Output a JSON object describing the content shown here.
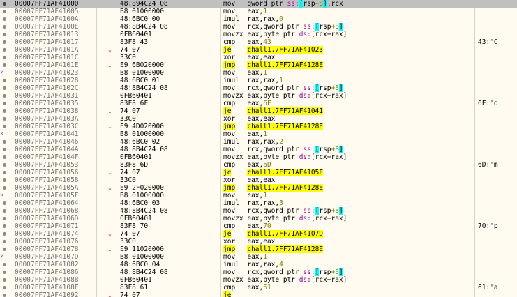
{
  "view": "disassembly",
  "rows": [
    {
      "addr": "00007FF71AF41000",
      "bytes": "48:894C24 08",
      "ins": "mov",
      "ops": [
        [
          "reg",
          "qword ptr "
        ],
        [
          "seg",
          "ss:"
        ],
        [
          "br",
          "["
        ],
        [
          "reg",
          "rsp"
        ],
        [
          "imm",
          "+8"
        ],
        [
          "br",
          "]"
        ],
        [
          "reg",
          ",rcx"
        ]
      ],
      "comment": "",
      "jump": false,
      "sel": true,
      "arrow": ""
    },
    {
      "addr": "00007FF71AF41005",
      "bytes": "B8 01000000",
      "ins": "mov",
      "ops": [
        [
          "reg",
          "eax,"
        ],
        [
          "imm",
          "1"
        ]
      ],
      "comment": "",
      "jump": false
    },
    {
      "addr": "00007FF71AF4100A",
      "bytes": "48:6BC0 00",
      "ins": "imul",
      "ops": [
        [
          "reg",
          "rax,rax,"
        ],
        [
          "imm",
          "0"
        ]
      ],
      "comment": "",
      "jump": false
    },
    {
      "addr": "00007FF71AF4100E",
      "bytes": "48:8B4C24 08",
      "ins": "mov",
      "ops": [
        [
          "reg",
          "rcx,qword ptr "
        ],
        [
          "seg",
          "ss:"
        ],
        [
          "br",
          "["
        ],
        [
          "reg",
          "rsp"
        ],
        [
          "imm",
          "+8"
        ],
        [
          "br",
          "]"
        ]
      ],
      "comment": "",
      "jump": false
    },
    {
      "addr": "00007FF71AF41013",
      "bytes": "0FB60401",
      "ins": "movzx",
      "ops": [
        [
          "reg",
          "eax,byte ptr "
        ],
        [
          "seg",
          "ds:"
        ],
        [
          "reg",
          "[rcx+rax]"
        ]
      ],
      "comment": "",
      "jump": false
    },
    {
      "addr": "00007FF71AF41017",
      "bytes": "83F8 43",
      "ins": "cmp",
      "ops": [
        [
          "reg",
          "eax,"
        ],
        [
          "imm",
          "43"
        ]
      ],
      "comment": "43:'C'",
      "jump": false
    },
    {
      "addr": "00007FF71AF4101A",
      "bytes": "74 07",
      "ins": "je",
      "ops": [
        [
          "tgt",
          "chall1.7FF71AF41023"
        ]
      ],
      "comment": "",
      "jump": true,
      "chev": true
    },
    {
      "addr": "00007FF71AF4101C",
      "bytes": "33C0",
      "ins": "xor",
      "ops": [
        [
          "reg",
          "eax,eax"
        ]
      ],
      "comment": "",
      "jump": false
    },
    {
      "addr": "00007FF71AF4101E",
      "bytes": "E9 6B020000",
      "ins": "jmp",
      "ops": [
        [
          "tgt",
          "chall1.7FF71AF4128E"
        ]
      ],
      "comment": "",
      "jump": true,
      "chev": true
    },
    {
      "addr": "00007FF71AF41023",
      "bytes": "B8 01000000",
      "ins": "mov",
      "ops": [
        [
          "reg",
          "eax,"
        ],
        [
          "imm",
          "1"
        ]
      ],
      "comment": "",
      "jump": false,
      "arrow": "->"
    },
    {
      "addr": "00007FF71AF41028",
      "bytes": "48:6BC0 01",
      "ins": "imul",
      "ops": [
        [
          "reg",
          "rax,rax,"
        ],
        [
          "imm",
          "1"
        ]
      ],
      "comment": "",
      "jump": false
    },
    {
      "addr": "00007FF71AF4102C",
      "bytes": "48:8B4C24 08",
      "ins": "mov",
      "ops": [
        [
          "reg",
          "rcx,qword ptr "
        ],
        [
          "seg",
          "ss:"
        ],
        [
          "br",
          "["
        ],
        [
          "reg",
          "rsp"
        ],
        [
          "imm",
          "+8"
        ],
        [
          "br",
          "]"
        ]
      ],
      "comment": "",
      "jump": false
    },
    {
      "addr": "00007FF71AF41031",
      "bytes": "0FB60401",
      "ins": "movzx",
      "ops": [
        [
          "reg",
          "eax,byte ptr "
        ],
        [
          "seg",
          "ds:"
        ],
        [
          "reg",
          "[rcx+rax]"
        ]
      ],
      "comment": "",
      "jump": false
    },
    {
      "addr": "00007FF71AF41035",
      "bytes": "83F8 6F",
      "ins": "cmp",
      "ops": [
        [
          "reg",
          "eax,"
        ],
        [
          "imm",
          "6F"
        ]
      ],
      "comment": "6F:'o'",
      "jump": false
    },
    {
      "addr": "00007FF71AF41038",
      "bytes": "74 07",
      "ins": "je",
      "ops": [
        [
          "tgt",
          "chall1.7FF71AF41041"
        ]
      ],
      "comment": "",
      "jump": true,
      "chev": true
    },
    {
      "addr": "00007FF71AF4103A",
      "bytes": "33C0",
      "ins": "xor",
      "ops": [
        [
          "reg",
          "eax,eax"
        ]
      ],
      "comment": "",
      "jump": false
    },
    {
      "addr": "00007FF71AF4103C",
      "bytes": "E9 4D020000",
      "ins": "jmp",
      "ops": [
        [
          "tgt",
          "chall1.7FF71AF4128E"
        ]
      ],
      "comment": "",
      "jump": true,
      "chev": true
    },
    {
      "addr": "00007FF71AF41041",
      "bytes": "B8 01000000",
      "ins": "mov",
      "ops": [
        [
          "reg",
          "eax,"
        ],
        [
          "imm",
          "1"
        ]
      ],
      "comment": "",
      "jump": false,
      "arrow": "->"
    },
    {
      "addr": "00007FF71AF41046",
      "bytes": "48:6BC0 02",
      "ins": "imul",
      "ops": [
        [
          "reg",
          "rax,rax,"
        ],
        [
          "imm",
          "2"
        ]
      ],
      "comment": "",
      "jump": false
    },
    {
      "addr": "00007FF71AF4104A",
      "bytes": "48:8B4C24 08",
      "ins": "mov",
      "ops": [
        [
          "reg",
          "rcx,qword ptr "
        ],
        [
          "seg",
          "ss:"
        ],
        [
          "br",
          "["
        ],
        [
          "reg",
          "rsp"
        ],
        [
          "imm",
          "+8"
        ],
        [
          "br",
          "]"
        ]
      ],
      "comment": "",
      "jump": false
    },
    {
      "addr": "00007FF71AF4104F",
      "bytes": "0FB60401",
      "ins": "movzx",
      "ops": [
        [
          "reg",
          "eax,byte ptr "
        ],
        [
          "seg",
          "ds:"
        ],
        [
          "reg",
          "[rcx+rax]"
        ]
      ],
      "comment": "",
      "jump": false
    },
    {
      "addr": "00007FF71AF41053",
      "bytes": "83F8 6D",
      "ins": "cmp",
      "ops": [
        [
          "reg",
          "eax,"
        ],
        [
          "imm",
          "6D"
        ]
      ],
      "comment": "6D:'m'",
      "jump": false
    },
    {
      "addr": "00007FF71AF41056",
      "bytes": "74 07",
      "ins": "je",
      "ops": [
        [
          "tgt",
          "chall1.7FF71AF4105F"
        ]
      ],
      "comment": "",
      "jump": true,
      "chev": true
    },
    {
      "addr": "00007FF71AF41058",
      "bytes": "33C0",
      "ins": "xor",
      "ops": [
        [
          "reg",
          "eax,eax"
        ]
      ],
      "comment": "",
      "jump": false
    },
    {
      "addr": "00007FF71AF4105A",
      "bytes": "E9 2F020000",
      "ins": "jmp",
      "ops": [
        [
          "tgt",
          "chall1.7FF71AF4128E"
        ]
      ],
      "comment": "",
      "jump": true,
      "chev": true
    },
    {
      "addr": "00007FF71AF4105F",
      "bytes": "B8 01000000",
      "ins": "mov",
      "ops": [
        [
          "reg",
          "eax,"
        ],
        [
          "imm",
          "1"
        ]
      ],
      "comment": "",
      "jump": false,
      "arrow": "->"
    },
    {
      "addr": "00007FF71AF41064",
      "bytes": "48:6BC0 03",
      "ins": "imul",
      "ops": [
        [
          "reg",
          "rax,rax,"
        ],
        [
          "imm",
          "3"
        ]
      ],
      "comment": "",
      "jump": false
    },
    {
      "addr": "00007FF71AF41068",
      "bytes": "48:8B4C24 08",
      "ins": "mov",
      "ops": [
        [
          "reg",
          "rcx,qword ptr "
        ],
        [
          "seg",
          "ss:"
        ],
        [
          "br",
          "["
        ],
        [
          "reg",
          "rsp"
        ],
        [
          "imm",
          "+8"
        ],
        [
          "br",
          "]"
        ]
      ],
      "comment": "",
      "jump": false
    },
    {
      "addr": "00007FF71AF4106D",
      "bytes": "0FB60401",
      "ins": "movzx",
      "ops": [
        [
          "reg",
          "eax,byte ptr "
        ],
        [
          "seg",
          "ds:"
        ],
        [
          "reg",
          "[rcx+rax]"
        ]
      ],
      "comment": "",
      "jump": false
    },
    {
      "addr": "00007FF71AF41071",
      "bytes": "83F8 70",
      "ins": "cmp",
      "ops": [
        [
          "reg",
          "eax,"
        ],
        [
          "imm",
          "70"
        ]
      ],
      "comment": "70:'p'",
      "jump": false
    },
    {
      "addr": "00007FF71AF41074",
      "bytes": "74 07",
      "ins": "je",
      "ops": [
        [
          "tgt",
          "chall1.7FF71AF4107D"
        ]
      ],
      "comment": "",
      "jump": true,
      "chev": true
    },
    {
      "addr": "00007FF71AF41076",
      "bytes": "33C0",
      "ins": "xor",
      "ops": [
        [
          "reg",
          "eax,eax"
        ]
      ],
      "comment": "",
      "jump": false
    },
    {
      "addr": "00007FF71AF41078",
      "bytes": "E9 11020000",
      "ins": "jmp",
      "ops": [
        [
          "tgt",
          "chall1.7FF71AF4128E"
        ]
      ],
      "comment": "",
      "jump": true,
      "chev": true
    },
    {
      "addr": "00007FF71AF4107D",
      "bytes": "B8 01000000",
      "ins": "mov",
      "ops": [
        [
          "reg",
          "eax,"
        ],
        [
          "imm",
          "1"
        ]
      ],
      "comment": "",
      "jump": false,
      "arrow": "->"
    },
    {
      "addr": "00007FF71AF41082",
      "bytes": "48:6BC0 04",
      "ins": "imul",
      "ops": [
        [
          "reg",
          "rax,rax,"
        ],
        [
          "imm",
          "4"
        ]
      ],
      "comment": "",
      "jump": false
    },
    {
      "addr": "00007FF71AF41086",
      "bytes": "48:8B4C24 08",
      "ins": "mov",
      "ops": [
        [
          "reg",
          "rcx,qword ptr "
        ],
        [
          "seg",
          "ss:"
        ],
        [
          "br",
          "["
        ],
        [
          "reg",
          "rsp"
        ],
        [
          "imm",
          "+8"
        ],
        [
          "br",
          "]"
        ]
      ],
      "comment": "",
      "jump": false
    },
    {
      "addr": "00007FF71AF4108B",
      "bytes": "0FB60401",
      "ins": "movzx",
      "ops": [
        [
          "reg",
          "eax,byte ptr "
        ],
        [
          "seg",
          "ds:"
        ],
        [
          "reg",
          "[rcx+rax]"
        ]
      ],
      "comment": "",
      "jump": false
    },
    {
      "addr": "00007FF71AF4108F",
      "bytes": "83F8 61",
      "ins": "cmp",
      "ops": [
        [
          "reg",
          "eax,"
        ],
        [
          "imm",
          "61"
        ]
      ],
      "comment": "61:'a'",
      "jump": false
    },
    {
      "addr": "00007FF71AF41092",
      "bytes": "74 07",
      "ins": "je",
      "ops": [
        [
          "tgt",
          ""
        ]
      ],
      "comment": "",
      "jump": true,
      "chev": true
    }
  ]
}
